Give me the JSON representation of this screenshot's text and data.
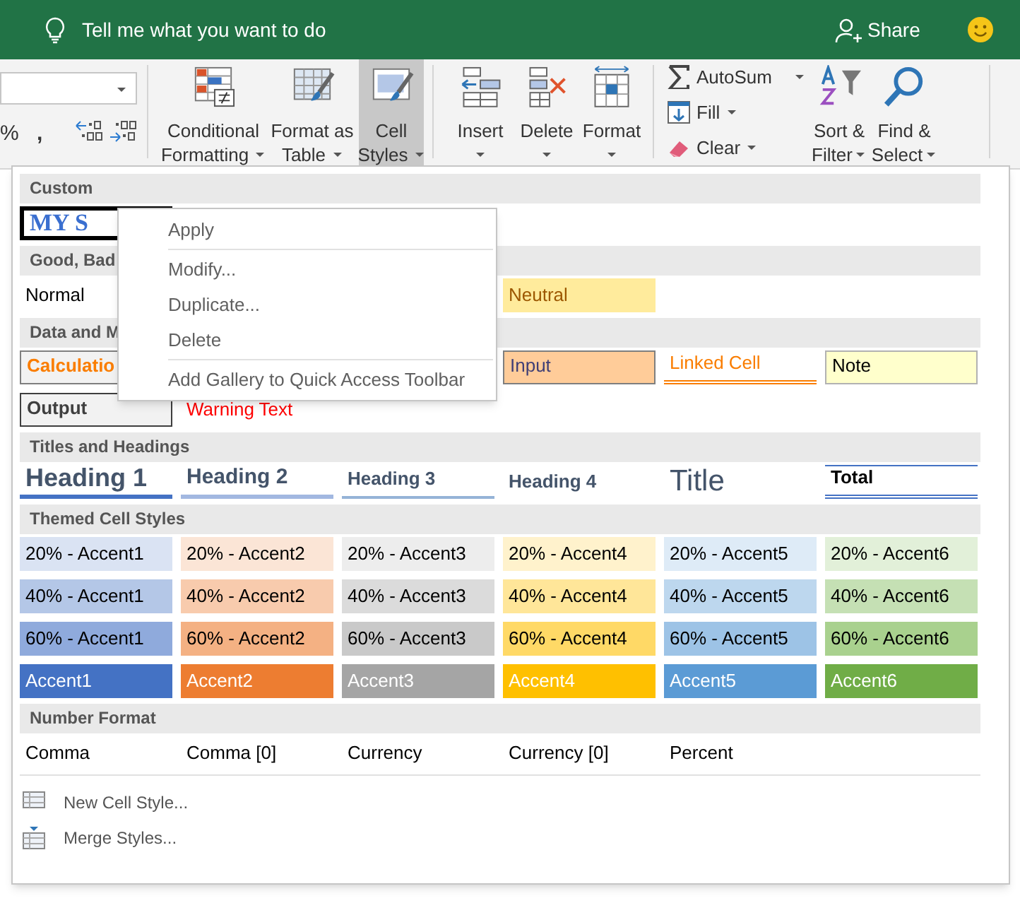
{
  "title_bar": {
    "tell_me": "Tell me what you want to do",
    "share": "Share"
  },
  "ribbon": {
    "number_buttons": [
      {
        "label": "%"
      },
      {
        "label": ","
      }
    ],
    "big_buttons": [
      {
        "label": "Conditional",
        "label2": "Formatting",
        "selected": false
      },
      {
        "label": "Format as",
        "label2": "Table",
        "selected": false
      },
      {
        "label": "Cell",
        "label2": "Styles",
        "selected": true
      },
      {
        "label": "Insert",
        "selected": false
      },
      {
        "label": "Delete",
        "selected": false
      },
      {
        "label": "Format",
        "selected": false
      }
    ],
    "editing": [
      {
        "label": "AutoSum"
      },
      {
        "label": "Fill"
      },
      {
        "label": "Clear"
      }
    ],
    "sort": [
      {
        "label": "Sort &",
        "label2": "Filter"
      },
      {
        "label": "Find &",
        "label2": "Select"
      }
    ]
  },
  "gallery": {
    "sections": [
      {
        "header": "Custom",
        "rows": [
          [
            {
              "text": "MY S",
              "kind": "custom"
            }
          ]
        ]
      },
      {
        "header": "Good, Bad",
        "rows": [
          [
            {
              "text": "Normal",
              "kind": "normal"
            },
            null,
            null,
            {
              "text": "Neutral",
              "kind": "neutral"
            }
          ]
        ]
      },
      {
        "header": "Data and M",
        "rows": [
          [
            {
              "text": "Calculatio",
              "kind": "calculation"
            },
            null,
            null,
            {
              "text": "Input",
              "kind": "input"
            },
            {
              "text": "Linked Cell",
              "kind": "linked"
            },
            {
              "text": "Note",
              "kind": "note"
            }
          ],
          [
            {
              "text": "Output",
              "kind": "output"
            },
            {
              "text": "Warning Text",
              "kind": "warning"
            }
          ]
        ]
      },
      {
        "header": "Titles and Headings",
        "rows": [
          [
            {
              "text": "Heading 1",
              "kind": "h1"
            },
            {
              "text": "Heading 2",
              "kind": "h2"
            },
            {
              "text": "Heading 3",
              "kind": "h3"
            },
            {
              "text": "Heading 4",
              "kind": "h4"
            },
            {
              "text": "Title",
              "kind": "title"
            },
            {
              "text": "Total",
              "kind": "total"
            }
          ]
        ]
      },
      {
        "header": "Themed Cell Styles",
        "rows": [
          [
            {
              "text": "20% - Accent1",
              "kind": "a1_20"
            },
            {
              "text": "20% - Accent2",
              "kind": "a2_20"
            },
            {
              "text": "20% - Accent3",
              "kind": "a3_20"
            },
            {
              "text": "20% - Accent4",
              "kind": "a4_20"
            },
            {
              "text": "20% - Accent5",
              "kind": "a5_20"
            },
            {
              "text": "20% - Accent6",
              "kind": "a6_20"
            }
          ],
          [
            {
              "text": "40% - Accent1",
              "kind": "a1_40"
            },
            {
              "text": "40% - Accent2",
              "kind": "a2_40"
            },
            {
              "text": "40% - Accent3",
              "kind": "a3_40"
            },
            {
              "text": "40% - Accent4",
              "kind": "a4_40"
            },
            {
              "text": "40% - Accent5",
              "kind": "a5_40"
            },
            {
              "text": "40% - Accent6",
              "kind": "a6_40"
            }
          ],
          [
            {
              "text": "60% - Accent1",
              "kind": "a1_60"
            },
            {
              "text": "60% - Accent2",
              "kind": "a2_60"
            },
            {
              "text": "60% - Accent3",
              "kind": "a3_60"
            },
            {
              "text": "60% - Accent4",
              "kind": "a4_60"
            },
            {
              "text": "60% - Accent5",
              "kind": "a5_60"
            },
            {
              "text": "60% - Accent6",
              "kind": "a6_60"
            }
          ],
          [
            {
              "text": "Accent1",
              "kind": "a1"
            },
            {
              "text": "Accent2",
              "kind": "a2"
            },
            {
              "text": "Accent3",
              "kind": "a3"
            },
            {
              "text": "Accent4",
              "kind": "a4"
            },
            {
              "text": "Accent5",
              "kind": "a5"
            },
            {
              "text": "Accent6",
              "kind": "a6"
            }
          ]
        ]
      },
      {
        "header": "Number Format",
        "rows": [
          [
            {
              "text": "Comma",
              "kind": "normal"
            },
            {
              "text": "Comma [0]",
              "kind": "normal"
            },
            {
              "text": "Currency",
              "kind": "normal"
            },
            {
              "text": "Currency [0]",
              "kind": "normal"
            },
            {
              "text": "Percent",
              "kind": "normal"
            }
          ]
        ]
      }
    ],
    "commands": [
      {
        "label": "New Cell Style..."
      },
      {
        "label": "Merge Styles..."
      }
    ]
  },
  "context_menu": [
    {
      "label": "Apply",
      "divider_after": true
    },
    {
      "label": "Modify...",
      "divider_after": false
    },
    {
      "label": "Duplicate...",
      "divider_after": false
    },
    {
      "label": "Delete",
      "divider_after": true
    },
    {
      "label": "Add Gallery to Quick Access Toolbar",
      "divider_after": false
    }
  ]
}
